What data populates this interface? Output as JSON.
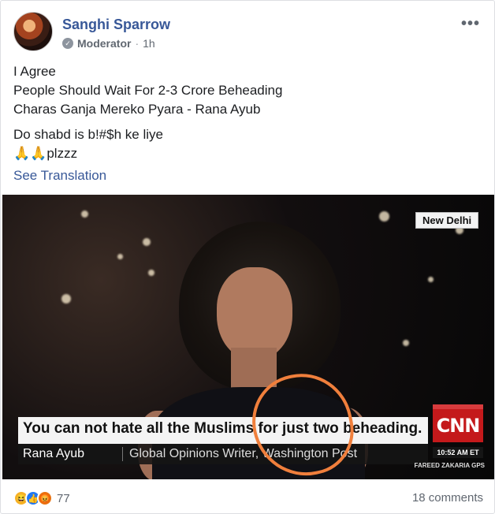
{
  "post": {
    "author": "Sanghi Sparrow",
    "role": "Moderator",
    "separator": "·",
    "time": "1h",
    "more_label": "•••",
    "text": {
      "line1": "I Agree",
      "line2": "People Should Wait For 2-3 Crore Beheading",
      "line3": "Charas Ganja Mereko Pyara - Rana Ayub",
      "line4": "Do shabd is b!#$h ke liye",
      "line5": "🙏🙏plzzz"
    },
    "see_translation": "See Translation"
  },
  "image": {
    "location": "New Delhi",
    "headline": "You can not hate all the Muslims for just two beheading.",
    "subject_name": "Rana Ayub",
    "subject_title": "Global Opinions Writer, Washington Post",
    "network": "CNN",
    "time": "10:52 AM ET",
    "show": "FAREED ZAKARIA GPS",
    "annotation_color": "#f07f3c"
  },
  "footer": {
    "reaction_icons": [
      "haha-icon",
      "like-icon",
      "angry-icon"
    ],
    "reaction_count": "77",
    "comments": "18 comments"
  }
}
